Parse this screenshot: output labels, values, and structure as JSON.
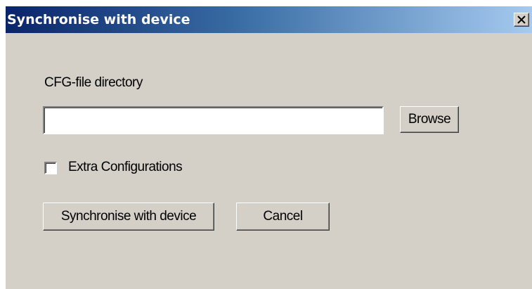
{
  "window": {
    "title": "Synchronise with device"
  },
  "icons": {
    "close": "close-icon"
  },
  "form": {
    "directory_label": "CFG-file directory",
    "directory_value": "",
    "directory_placeholder": "",
    "browse_label": "Browse",
    "extra_config_label": "Extra Configurations",
    "extra_config_checked": false,
    "sync_label": "Synchronise with device",
    "cancel_label": "Cancel"
  },
  "colors": {
    "window_bg": "#d4d0c8",
    "title_gradient_start": "#0a246a",
    "title_gradient_end": "#a6caf0",
    "title_text": "#ffffff"
  }
}
